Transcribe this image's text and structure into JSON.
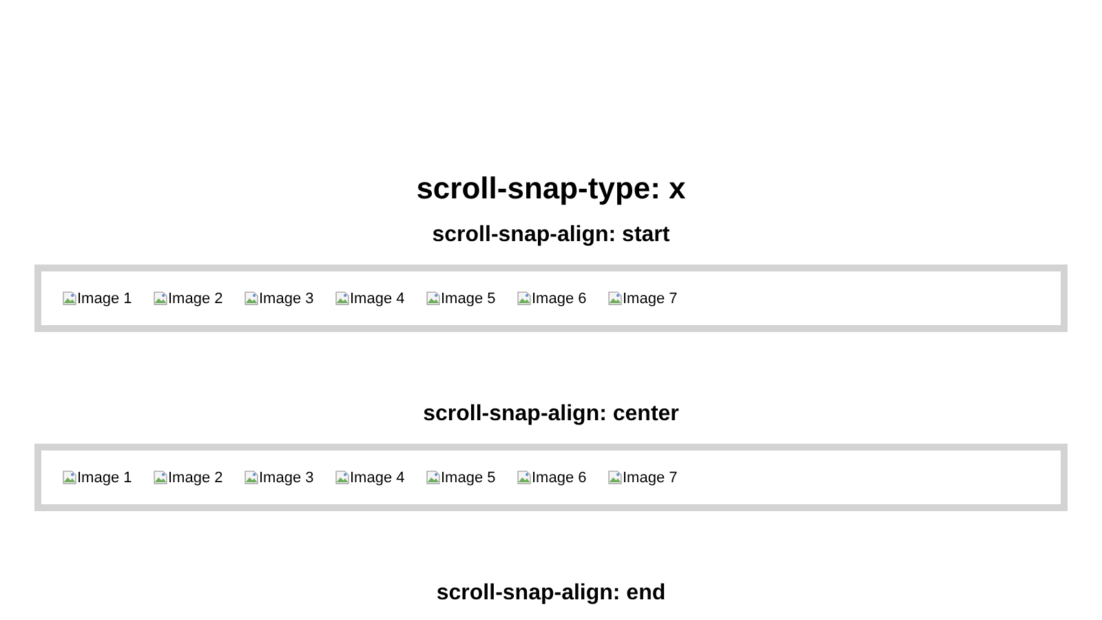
{
  "title": "scroll-snap-type: x",
  "sections": [
    {
      "heading": "scroll-snap-align: start",
      "images": [
        "Image 1",
        "Image 2",
        "Image 3",
        "Image 4",
        "Image 5",
        "Image 6",
        "Image 7"
      ]
    },
    {
      "heading": "scroll-snap-align: center",
      "images": [
        "Image 1",
        "Image 2",
        "Image 3",
        "Image 4",
        "Image 5",
        "Image 6",
        "Image 7"
      ]
    },
    {
      "heading": "scroll-snap-align: end"
    }
  ]
}
